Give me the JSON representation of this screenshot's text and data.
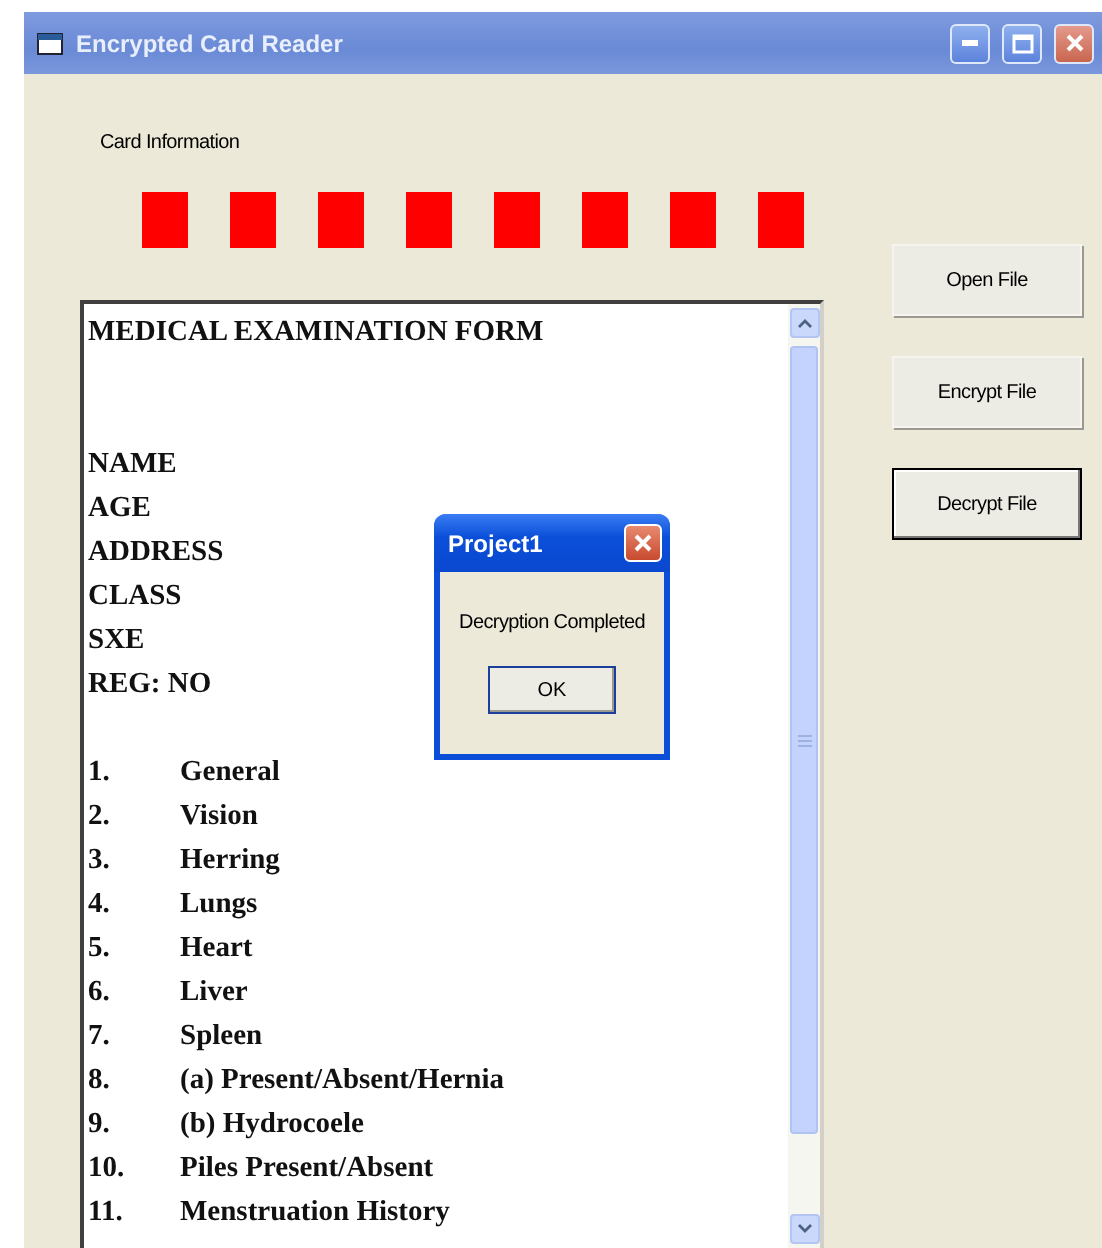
{
  "window": {
    "title": "Encrypted Card Reader"
  },
  "card_information": {
    "label": "Card Information",
    "indicators": [
      {
        "color": "#ff0000"
      },
      {
        "color": "#ff0000"
      },
      {
        "color": "#ff0000"
      },
      {
        "color": "#ff0000"
      },
      {
        "color": "#ff0000"
      },
      {
        "color": "#ff0000"
      },
      {
        "color": "#ff0000"
      },
      {
        "color": "#ff0000"
      }
    ]
  },
  "document": {
    "title": "MEDICAL EXAMINATION FORM",
    "fields": [
      "NAME",
      "AGE",
      "ADDRESS",
      "CLASS",
      "SXE",
      "REG: NO"
    ],
    "items": [
      {
        "number": "1.",
        "label": "General"
      },
      {
        "number": "2.",
        "label": "Vision"
      },
      {
        "number": "3.",
        "label": "Herring"
      },
      {
        "number": "4.",
        "label": "Lungs"
      },
      {
        "number": "5.",
        "label": "Heart"
      },
      {
        "number": "6.",
        "label": "Liver"
      },
      {
        "number": "7.",
        "label": "Spleen"
      },
      {
        "number": "8.",
        "label": "(a) Present/Absent/Hernia"
      },
      {
        "number": "9.",
        "label": "(b) Hydrocoele"
      },
      {
        "number": "10.",
        "label": "Piles Present/Absent"
      },
      {
        "number": "11.",
        "label": "Menstruation History"
      }
    ]
  },
  "buttons": [
    {
      "label": "Open File",
      "focused": false
    },
    {
      "label": "Encrypt File",
      "focused": false
    },
    {
      "label": "Decrypt File",
      "focused": true
    }
  ],
  "dialog": {
    "title": "Project1",
    "message": "Decryption Completed",
    "button": "OK"
  }
}
